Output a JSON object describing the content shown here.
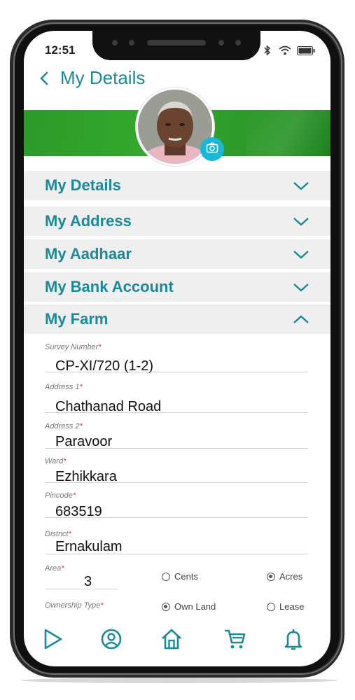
{
  "status_bar": {
    "time": "12:51"
  },
  "header": {
    "title": "My Details"
  },
  "sections": [
    {
      "label": "My Details",
      "expanded": false
    },
    {
      "label": "My Address",
      "expanded": false
    },
    {
      "label": "My Aadhaar",
      "expanded": false
    },
    {
      "label": "My Bank Account",
      "expanded": false
    },
    {
      "label": "My Farm",
      "expanded": true
    }
  ],
  "farm_form": {
    "survey_number": {
      "label": "Survey Number",
      "required": "*",
      "value": "CP-XI/720 (1-2)"
    },
    "address1": {
      "label": "Address 1",
      "required": "*",
      "value": "Chathanad Road"
    },
    "address2": {
      "label": "Address 2",
      "required": "*",
      "value": "Paravoor"
    },
    "ward": {
      "label": "Ward",
      "required": "*",
      "value": "Ezhikkara"
    },
    "pincode": {
      "label": "Pincode",
      "required": "*",
      "value": "683519"
    },
    "district": {
      "label": "District",
      "required": "*",
      "value": "Ernakulam"
    },
    "area": {
      "label": "Area",
      "required": "*",
      "value": "3",
      "unit_options": [
        {
          "label": "Cents",
          "selected": false
        },
        {
          "label": "Acres",
          "selected": true
        }
      ]
    },
    "ownership": {
      "label": "Ownership Type",
      "required": "*",
      "options": [
        {
          "label": "Own Land",
          "selected": true
        },
        {
          "label": "Lease",
          "selected": false
        }
      ]
    }
  },
  "bottom_nav": [
    {
      "icon": "play-icon"
    },
    {
      "icon": "profile-icon"
    },
    {
      "icon": "home-icon"
    },
    {
      "icon": "cart-icon"
    },
    {
      "icon": "bell-icon"
    }
  ],
  "colors": {
    "accent": "#1a8a9a",
    "banner_green": "#2d9a2a",
    "camera_blue": "#19b8d6",
    "section_bg": "#efefef",
    "required_red": "#d33333"
  }
}
